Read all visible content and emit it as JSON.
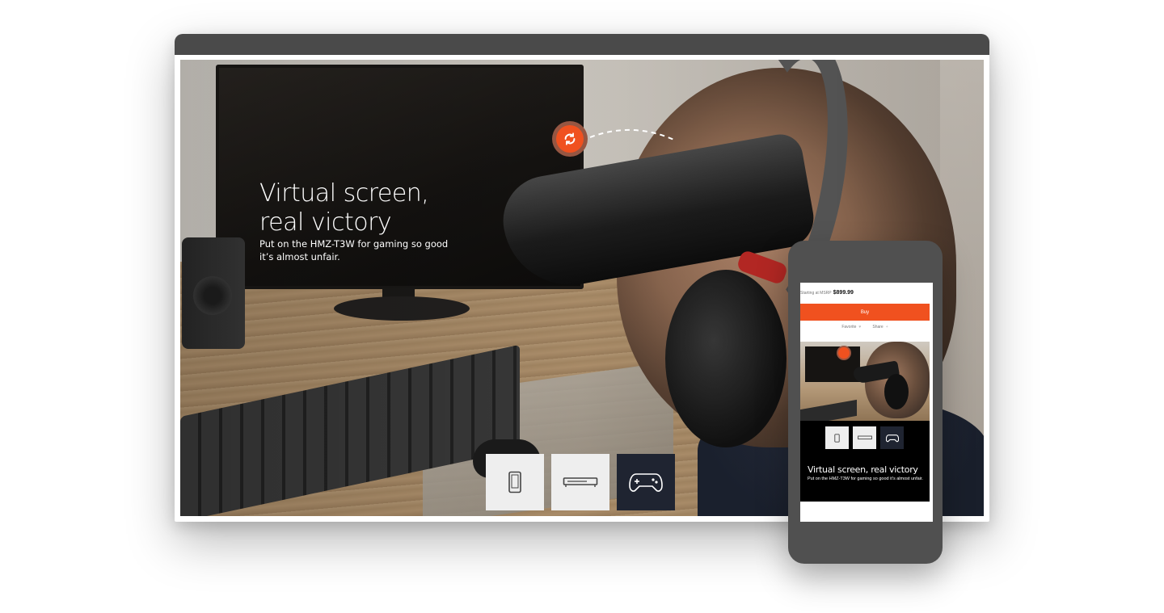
{
  "hero": {
    "title": "Virtual screen, real victory",
    "title_line1": "Virtual screen,",
    "title_line2": "real victory",
    "subtitle_line1": "Put on the HMZ-T3W for gaming so good",
    "subtitle_line2": "it’s almost unfair."
  },
  "tiles": [
    {
      "icon": "mobile-device-icon",
      "active": false
    },
    {
      "icon": "set-top-box-icon",
      "active": false
    },
    {
      "icon": "game-controller-icon",
      "active": true
    }
  ],
  "phone": {
    "price_label": "Starting at MSRP",
    "price_value": "$899.99",
    "buy_label": "Buy",
    "favorite_label": "Favorite",
    "favorite_icon": "heart-icon",
    "share_label": "Share",
    "share_icon": "plus-icon",
    "title": "Virtual screen, real victory",
    "subtitle": "Put on the HMZ-T3W for gaming so good it’s almost unfair."
  },
  "colors": {
    "accent": "#f0511f",
    "frame": "#4a4a4a",
    "active_tile": "#1f2431",
    "tile": "#eeeeee"
  }
}
